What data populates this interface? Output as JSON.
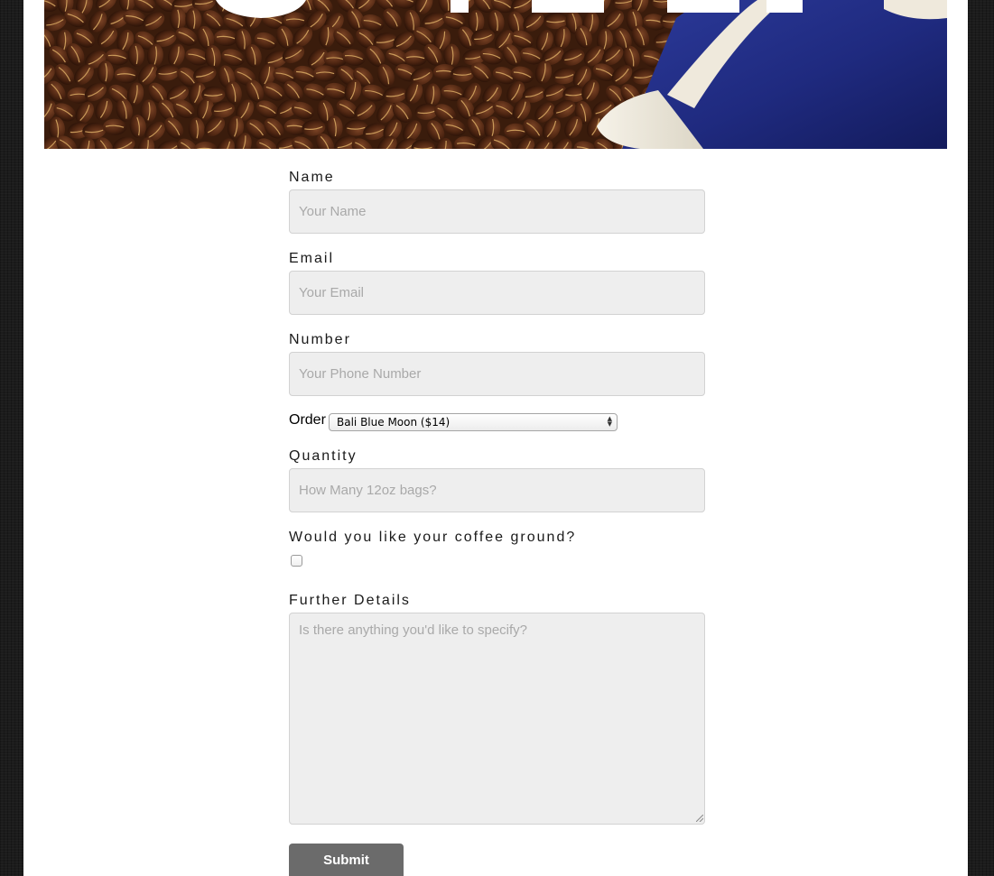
{
  "hero": {
    "heading": "ORDER"
  },
  "form": {
    "name": {
      "label": "Name",
      "placeholder": "Your Name"
    },
    "email": {
      "label": "Email",
      "placeholder": "Your Email"
    },
    "number": {
      "label": "Number",
      "placeholder": "Your Phone Number"
    },
    "order": {
      "label": "Order",
      "selected": "Bali Blue Moon ($14)"
    },
    "quantity": {
      "label": "Quantity",
      "placeholder": "How Many 12oz bags?"
    },
    "ground": {
      "label": "Would you like your coffee ground?",
      "checked": false
    },
    "details": {
      "label": "Further Details",
      "placeholder": "Is there anything you'd like to specify?"
    },
    "submit_label": "Submit"
  },
  "colors": {
    "field_bg": "#eeeeee",
    "submit_bg": "#6b6b6b",
    "page_bg": "#1c1c1c"
  }
}
